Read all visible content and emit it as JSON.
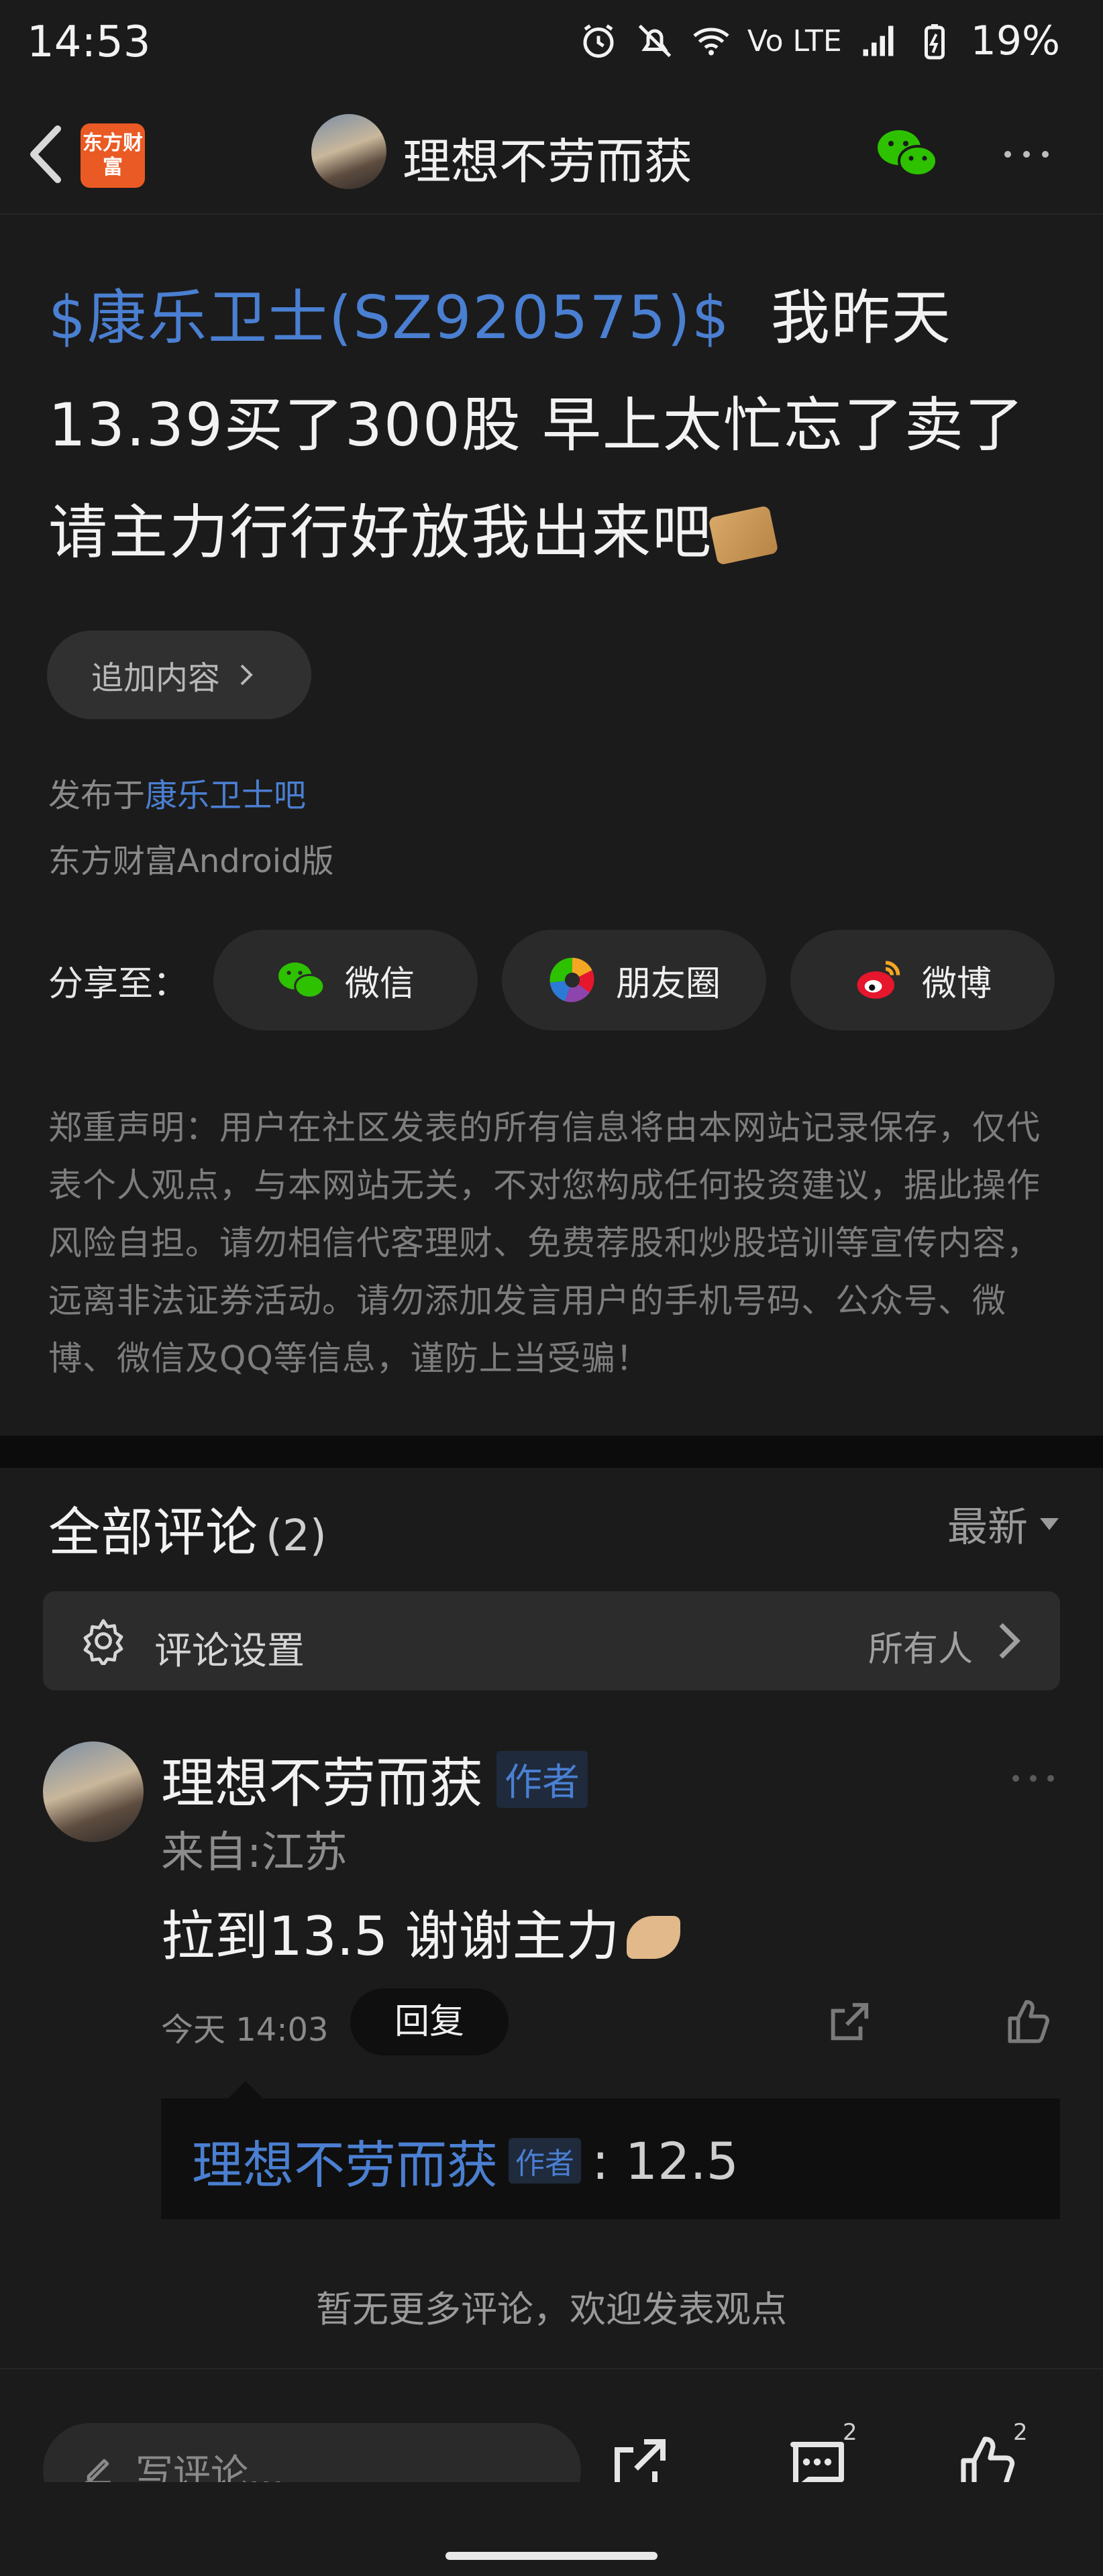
{
  "status_bar": {
    "time": "14:53",
    "battery": "19%",
    "network": "Vo LTE"
  },
  "nav": {
    "logo_text": "东方财富",
    "title": "理想不劳而获"
  },
  "post": {
    "stock_tag": "$康乐卫士(SZ920575)$",
    "body": "我昨天13.39买了300股 早上太忙忘了卖了 请主力行行好放我出来吧",
    "add_content_label": "追加内容",
    "published_prefix": "发布于",
    "published_forum": "康乐卫士吧",
    "client": "东方财富Android版",
    "share_label": "分享至：",
    "share_options": [
      "微信",
      "朋友圈",
      "微博"
    ],
    "disclaimer": "郑重声明：用户在社区发表的所有信息将由本网站记录保存，仅代表个人观点，与本网站无关，不对您构成任何投资建议，据此操作风险自担。请勿相信代客理财、免费荐股和炒股培训等宣传内容，远离非法证券活动。请勿添加发言用户的手机号码、公众号、微博、微信及QQ等信息，谨防上当受骗！"
  },
  "comments": {
    "heading": "全部评论",
    "count": "(2)",
    "sort": "最新",
    "settings_label": "评论设置",
    "settings_value": "所有人",
    "items": [
      {
        "user": "理想不劳而获",
        "tag": "作者",
        "location": "来自:江苏",
        "text": "拉到13.5 谢谢主力",
        "time": "今天 14:03",
        "reply_label": "回复",
        "replies": [
          {
            "user": "理想不劳而获",
            "tag": "作者",
            "text": ": 12.5"
          }
        ]
      }
    ],
    "no_more": "暂无更多评论，欢迎发表观点"
  },
  "bottom_bar": {
    "write_placeholder": "写评论...",
    "comment_count": "2",
    "like_count": "2"
  },
  "colors": {
    "background": "#1b1b1b",
    "link_blue": "#4a7fd1",
    "logo_orange": "#ea5a24",
    "wechat_green": "#2dc100",
    "weibo_red": "#e6162d"
  }
}
